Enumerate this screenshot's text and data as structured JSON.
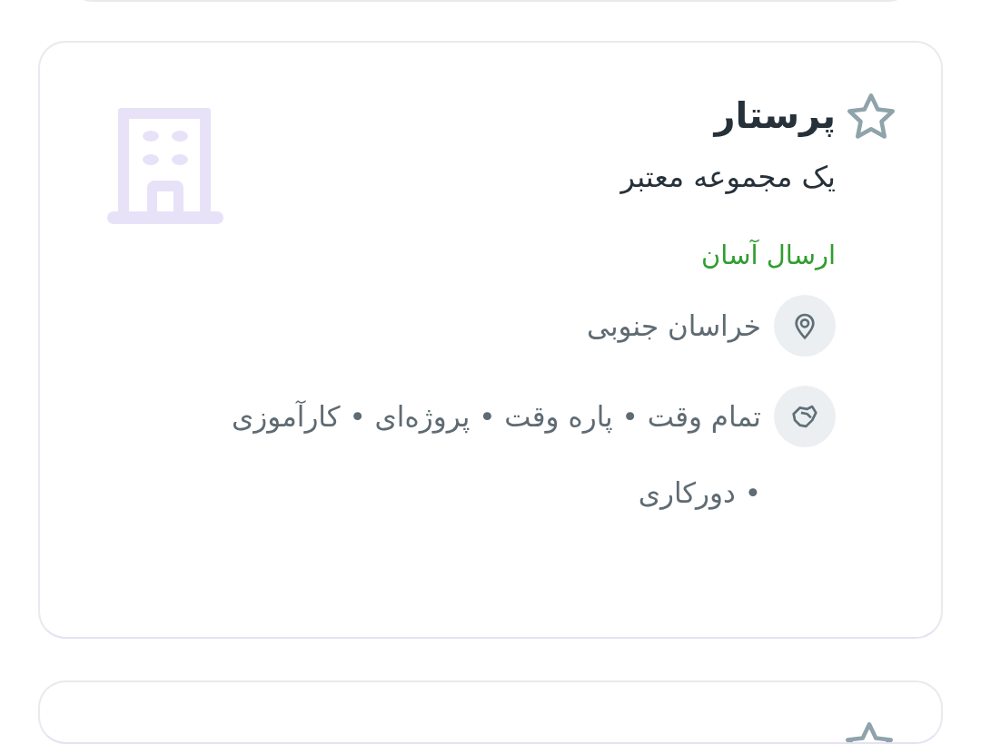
{
  "cards": [
    {
      "title": "پرستار",
      "favorite": false,
      "subtitle": "یک مجموعه معتبر",
      "badge": "ارسال آسان",
      "location": "خراسان جنوبی",
      "job_types": "تمام وقت • پاره وقت • پروژه‌ای • کارآموزی • دورکاری"
    },
    {
      "favorite": false
    }
  ]
}
